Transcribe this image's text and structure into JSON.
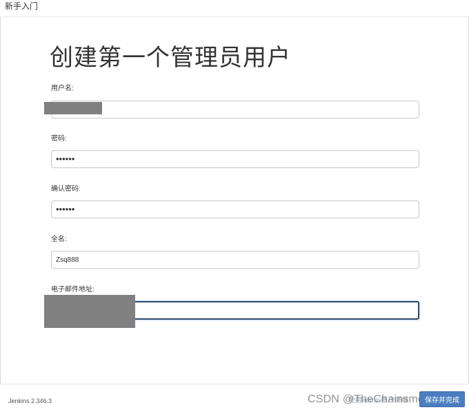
{
  "header": {
    "title": "新手入门"
  },
  "page": {
    "title": "创建第一个管理员用户"
  },
  "form": {
    "username": {
      "label": "用户名:",
      "value": ""
    },
    "password": {
      "label": "密码:",
      "value": "••••••"
    },
    "confirm_password": {
      "label": "确认密码:",
      "value": "••••••"
    },
    "full_name": {
      "label": "全名:",
      "value": "Zsq888"
    },
    "email": {
      "label": "电子邮件地址:",
      "value": ""
    }
  },
  "footer": {
    "version": "Jenkins 2.346.3",
    "skip_label": "使用admin账户继续",
    "save_label": "保存并完成",
    "watermark": "CSDN @TheChainsmoker"
  },
  "colors": {
    "primary_button": "#4a7ec0",
    "focus_border": "#2b4b6b",
    "redaction": "#808080"
  }
}
